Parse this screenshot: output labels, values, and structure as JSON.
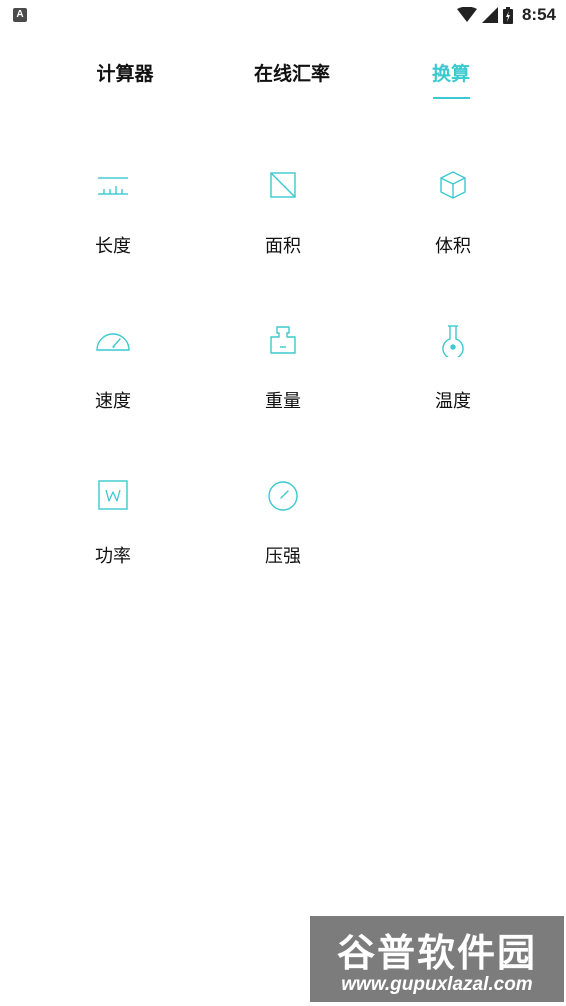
{
  "status_bar": {
    "app_icon_letter": "A",
    "time": "8:54"
  },
  "tabs": [
    {
      "label": "计算器",
      "active": false
    },
    {
      "label": "在线汇率",
      "active": false
    },
    {
      "label": "换算",
      "active": true
    }
  ],
  "accent_color": "#3cc9cf",
  "converters": [
    {
      "label": "长度",
      "icon": "ruler-icon"
    },
    {
      "label": "面积",
      "icon": "area-square-icon"
    },
    {
      "label": "体积",
      "icon": "cube-icon"
    },
    {
      "label": "速度",
      "icon": "speedometer-icon"
    },
    {
      "label": "重量",
      "icon": "weight-icon"
    },
    {
      "label": "温度",
      "icon": "thermometer-flask-icon"
    },
    {
      "label": "功率",
      "icon": "watt-box-icon"
    },
    {
      "label": "压强",
      "icon": "pressure-gauge-icon"
    }
  ],
  "watermark": {
    "title": "谷普软件园",
    "url": "www.gupuxlazal.com"
  }
}
